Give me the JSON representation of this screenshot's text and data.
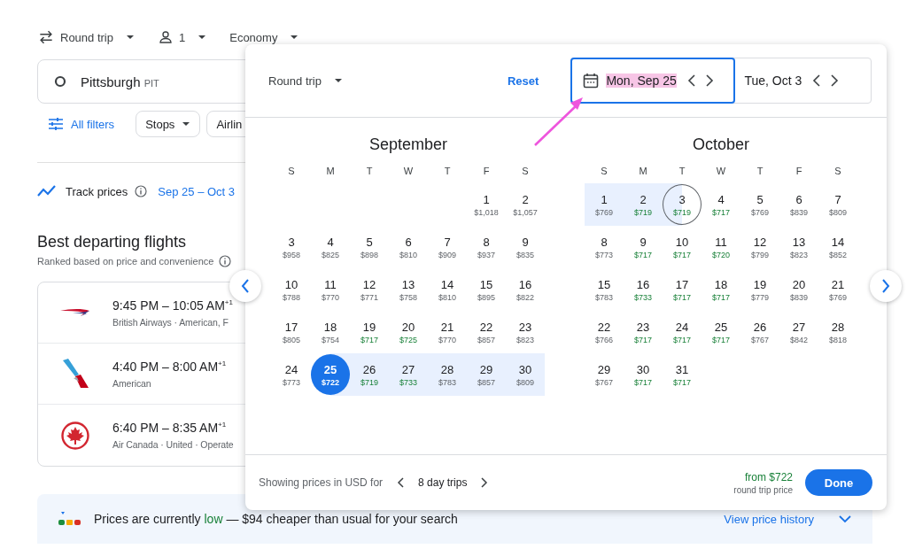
{
  "top_bar": {
    "trip_type": "Round trip",
    "passengers": "1",
    "cabin": "Economy"
  },
  "origin": {
    "city": "Pittsburgh",
    "code": "PIT"
  },
  "filters": {
    "all_filters": "All filters",
    "chips": [
      "Stops",
      "Airlin"
    ]
  },
  "track": {
    "label": "Track prices",
    "dates": "Sep 25 – Oct 3"
  },
  "results": {
    "title": "Best departing flights",
    "subtitle": "Ranked based on price and convenience",
    "flights": [
      {
        "kind": "ribbon",
        "times": "9:45 PM – 10:05 AM$^{+1}$",
        "airlines": "British Airways · American, F"
      },
      {
        "kind": "tail",
        "times": "4:40 PM – 8:00 AM$^{+1}$",
        "airlines": "American"
      },
      {
        "kind": "leaf",
        "times": "6:40 PM – 8:35 AM$^{+1}$",
        "airlines": "Air Canada · United · Operate"
      }
    ]
  },
  "insight": {
    "prefix": "Prices are currently ",
    "level_word": "low",
    "suffix": " — $94 cheaper than usual for your search",
    "link": "View price history"
  },
  "date_picker": {
    "trip_type": "Round trip",
    "reset": "Reset",
    "departure": {
      "value": "Mon, Sep 25",
      "focused": true,
      "highlighted": true
    },
    "return": {
      "value": "Tue, Oct 3",
      "focused": false,
      "highlighted": false
    },
    "months": [
      {
        "name": "September",
        "weekdays": [
          "S",
          "M",
          "T",
          "W",
          "T",
          "F",
          "S"
        ],
        "weeks": [
          [
            {
              "day": "1",
              "price": "$1,018",
              "low": false,
              "in_range": false,
              "kind": "date"
            },
            {
              "day": "2",
              "price": "$1,057",
              "low": false,
              "in_range": false,
              "kind": "date"
            }
          ],
          [
            {
              "day": "3",
              "price": "$958",
              "low": false,
              "in_range": false,
              "kind": "date"
            },
            {
              "day": "4",
              "price": "$825",
              "low": false,
              "in_range": false,
              "kind": "date"
            },
            {
              "day": "5",
              "price": "$898",
              "low": false,
              "in_range": false,
              "kind": "date"
            },
            {
              "day": "6",
              "price": "$810",
              "low": false,
              "in_range": false,
              "kind": "date"
            },
            {
              "day": "7",
              "price": "$909",
              "low": false,
              "in_range": false,
              "kind": "date"
            },
            {
              "day": "8",
              "price": "$937",
              "low": false,
              "in_range": false,
              "kind": "date"
            },
            {
              "day": "9",
              "price": "$835",
              "low": false,
              "in_range": false,
              "kind": "date"
            }
          ],
          [
            {
              "day": "10",
              "price": "$788",
              "low": false,
              "in_range": false,
              "kind": "date"
            },
            {
              "day": "11",
              "price": "$770",
              "low": false,
              "in_range": false,
              "kind": "date"
            },
            {
              "day": "12",
              "price": "$771",
              "low": false,
              "in_range": false,
              "kind": "date"
            },
            {
              "day": "13",
              "price": "$758",
              "low": false,
              "in_range": false,
              "kind": "date"
            },
            {
              "day": "14",
              "price": "$810",
              "low": false,
              "in_range": false,
              "kind": "date"
            },
            {
              "day": "15",
              "price": "$895",
              "low": false,
              "in_range": false,
              "kind": "date"
            },
            {
              "day": "16",
              "price": "$822",
              "low": false,
              "in_range": false,
              "kind": "date"
            }
          ],
          [
            {
              "day": "17",
              "price": "$805",
              "low": false,
              "in_range": false,
              "kind": "date"
            },
            {
              "day": "18",
              "price": "$754",
              "low": false,
              "in_range": false,
              "kind": "date"
            },
            {
              "day": "19",
              "price": "$717",
              "low": true,
              "in_range": false,
              "kind": "date"
            },
            {
              "day": "20",
              "price": "$725",
              "low": true,
              "in_range": false,
              "kind": "date"
            },
            {
              "day": "21",
              "price": "$770",
              "low": false,
              "in_range": false,
              "kind": "date"
            },
            {
              "day": "22",
              "price": "$857",
              "low": false,
              "in_range": false,
              "kind": "date"
            },
            {
              "day": "23",
              "price": "$823",
              "low": false,
              "in_range": false,
              "kind": "date"
            }
          ],
          [
            {
              "day": "24",
              "price": "$773",
              "low": false,
              "in_range": false,
              "kind": "date"
            },
            {
              "day": "25",
              "price": "$722",
              "low": false,
              "in_range": true,
              "kind": "start"
            },
            {
              "day": "26",
              "price": "$719",
              "low": true,
              "in_range": true,
              "kind": "date"
            },
            {
              "day": "27",
              "price": "$733",
              "low": true,
              "in_range": true,
              "kind": "date"
            },
            {
              "day": "28",
              "price": "$783",
              "low": false,
              "in_range": true,
              "kind": "date"
            },
            {
              "day": "29",
              "price": "$857",
              "low": false,
              "in_range": true,
              "kind": "date"
            },
            {
              "day": "30",
              "price": "$809",
              "low": false,
              "in_range": true,
              "kind": "date"
            }
          ]
        ]
      },
      {
        "name": "October",
        "weekdays": [
          "S",
          "M",
          "T",
          "W",
          "T",
          "F",
          "S"
        ],
        "weeks": [
          [
            {
              "day": "1",
              "price": "$769",
              "low": false,
              "in_range": true,
              "kind": "date"
            },
            {
              "day": "2",
              "price": "$719",
              "low": true,
              "in_range": true,
              "kind": "date"
            },
            {
              "day": "3",
              "price": "$719",
              "low": true,
              "in_range": true,
              "kind": "end"
            },
            {
              "day": "4",
              "price": "$717",
              "low": true,
              "in_range": false,
              "kind": "date"
            },
            {
              "day": "5",
              "price": "$769",
              "low": false,
              "in_range": false,
              "kind": "date"
            },
            {
              "day": "6",
              "price": "$839",
              "low": false,
              "in_range": false,
              "kind": "date"
            },
            {
              "day": "7",
              "price": "$809",
              "low": false,
              "in_range": false,
              "kind": "date"
            }
          ],
          [
            {
              "day": "8",
              "price": "$773",
              "low": false,
              "in_range": false,
              "kind": "date"
            },
            {
              "day": "9",
              "price": "$717",
              "low": true,
              "in_range": false,
              "kind": "date"
            },
            {
              "day": "10",
              "price": "$717",
              "low": true,
              "in_range": false,
              "kind": "date"
            },
            {
              "day": "11",
              "price": "$720",
              "low": true,
              "in_range": false,
              "kind": "date"
            },
            {
              "day": "12",
              "price": "$799",
              "low": false,
              "in_range": false,
              "kind": "date"
            },
            {
              "day": "13",
              "price": "$823",
              "low": false,
              "in_range": false,
              "kind": "date"
            },
            {
              "day": "14",
              "price": "$852",
              "low": false,
              "in_range": false,
              "kind": "date"
            }
          ],
          [
            {
              "day": "15",
              "price": "$783",
              "low": false,
              "in_range": false,
              "kind": "date"
            },
            {
              "day": "16",
              "price": "$733",
              "low": true,
              "in_range": false,
              "kind": "date"
            },
            {
              "day": "17",
              "price": "$717",
              "low": true,
              "in_range": false,
              "kind": "date"
            },
            {
              "day": "18",
              "price": "$717",
              "low": true,
              "in_range": false,
              "kind": "date"
            },
            {
              "day": "19",
              "price": "$779",
              "low": false,
              "in_range": false,
              "kind": "date"
            },
            {
              "day": "20",
              "price": "$839",
              "low": false,
              "in_range": false,
              "kind": "date"
            },
            {
              "day": "21",
              "price": "$769",
              "low": false,
              "in_range": false,
              "kind": "date"
            }
          ],
          [
            {
              "day": "22",
              "price": "$766",
              "low": false,
              "in_range": false,
              "kind": "date"
            },
            {
              "day": "23",
              "price": "$717",
              "low": true,
              "in_range": false,
              "kind": "date"
            },
            {
              "day": "24",
              "price": "$717",
              "low": true,
              "in_range": false,
              "kind": "date"
            },
            {
              "day": "25",
              "price": "$717",
              "low": true,
              "in_range": false,
              "kind": "date"
            },
            {
              "day": "26",
              "price": "$767",
              "low": false,
              "in_range": false,
              "kind": "date"
            },
            {
              "day": "27",
              "price": "$842",
              "low": false,
              "in_range": false,
              "kind": "date"
            },
            {
              "day": "28",
              "price": "$818",
              "low": false,
              "in_range": false,
              "kind": "date"
            }
          ],
          [
            {
              "day": "29",
              "price": "$767",
              "low": false,
              "in_range": false,
              "kind": "date"
            },
            {
              "day": "30",
              "price": "$717",
              "low": true,
              "in_range": false,
              "kind": "date"
            },
            {
              "day": "31",
              "price": "$717",
              "low": true,
              "in_range": false,
              "kind": "date"
            }
          ]
        ]
      }
    ],
    "footer": {
      "label": "Showing prices in USD for",
      "trip_length": "8 day trips",
      "from": "from $722",
      "from_note": "round trip price",
      "done": "Done"
    }
  }
}
